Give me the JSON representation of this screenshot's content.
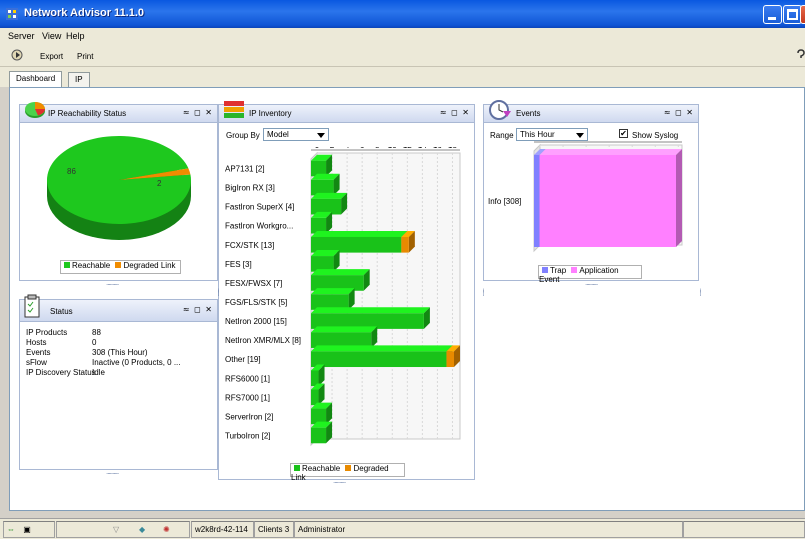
{
  "window": {
    "title": "Network Advisor 11.1.0"
  },
  "menu": [
    "Server",
    "View",
    "Help"
  ],
  "toolbar": {
    "export_label": "Export",
    "print_label": "Print"
  },
  "tabs": [
    {
      "label": "Dashboard"
    },
    {
      "label": "IP"
    }
  ],
  "controls": "≈ ◻ ✕",
  "reachability": {
    "title": "IP Reachability Status",
    "slices": [
      {
        "label": "Reachable",
        "value": 86,
        "color": "#1ec81e"
      },
      {
        "label": "Degraded Link",
        "value": 2,
        "color": "#f08c00"
      }
    ],
    "legend_reachable": "Reachable",
    "legend_degraded": "Degraded Link"
  },
  "status": {
    "title": "Status",
    "rows": [
      {
        "key": "IP Products",
        "value": "88"
      },
      {
        "key": "Hosts",
        "value": "0"
      },
      {
        "key": "Events",
        "value": "308 (This Hour)"
      },
      {
        "key": "sFlow",
        "value": "Inactive (0 Products, 0 ..."
      },
      {
        "key": "IP Discovery Status",
        "value": "Idle"
      }
    ]
  },
  "inventory": {
    "title": "IP Inventory",
    "group_by_label": "Group By",
    "group_by_value": "Model",
    "legend_reachable": "Reachable",
    "legend_degraded": "Degraded Link"
  },
  "events": {
    "title": "Events",
    "range_label": "Range",
    "range_value": "This Hour",
    "show_syslog_label": "Show Syslog",
    "show_syslog_checked": true,
    "legend_trap": "Trap",
    "legend_app": "Application Event"
  },
  "statusbar": {
    "server": "w2k8rd-42-114",
    "clients_label": "Clients",
    "clients_count": "3",
    "user": "Administrator"
  },
  "chart_data": [
    {
      "type": "bar",
      "orientation": "horizontal",
      "stacked": true,
      "categories": [
        "AP7131 [2]",
        "BigIron RX [3]",
        "FastIron SuperX [4]",
        "FastIron Workgro...",
        "FCX/STK [13]",
        "FES [3]",
        "FESX/FWSX [7]",
        "FGS/FLS/STK [5]",
        "NetIron 2000 [15]",
        "NetIron XMR/MLX [8]",
        "Other [19]",
        "RFS6000 [1]",
        "RFS7000 [1]",
        "ServerIron [2]",
        "TurboIron [2]"
      ],
      "series": [
        {
          "name": "Reachable",
          "values": [
            2,
            3,
            4,
            2,
            12,
            3,
            7,
            5,
            15,
            8,
            18,
            1,
            1,
            2,
            2
          ],
          "color": "#19c219"
        },
        {
          "name": "Degraded Link",
          "values": [
            0,
            0,
            0,
            0,
            1,
            0,
            0,
            0,
            0,
            0,
            1,
            0,
            0,
            0,
            0
          ],
          "color": "#e88a00"
        }
      ],
      "xticks": [
        0,
        2,
        4,
        6,
        8,
        10,
        12,
        14,
        16,
        18
      ],
      "xlim": [
        0,
        19
      ],
      "grid": true,
      "legend_position": "bottom"
    },
    {
      "type": "bar",
      "orientation": "horizontal",
      "stacked": true,
      "categories": [
        "Info [308]"
      ],
      "series": [
        {
          "name": "Trap",
          "values": [
            12
          ],
          "color": "#8080ff"
        },
        {
          "name": "Application Event",
          "values": [
            296
          ],
          "color": "#ff80ff"
        }
      ],
      "xticks": [
        0,
        50,
        100,
        150,
        200,
        250,
        300
      ],
      "xlim": [
        0,
        308
      ],
      "grid": true,
      "legend_position": "bottom"
    }
  ]
}
